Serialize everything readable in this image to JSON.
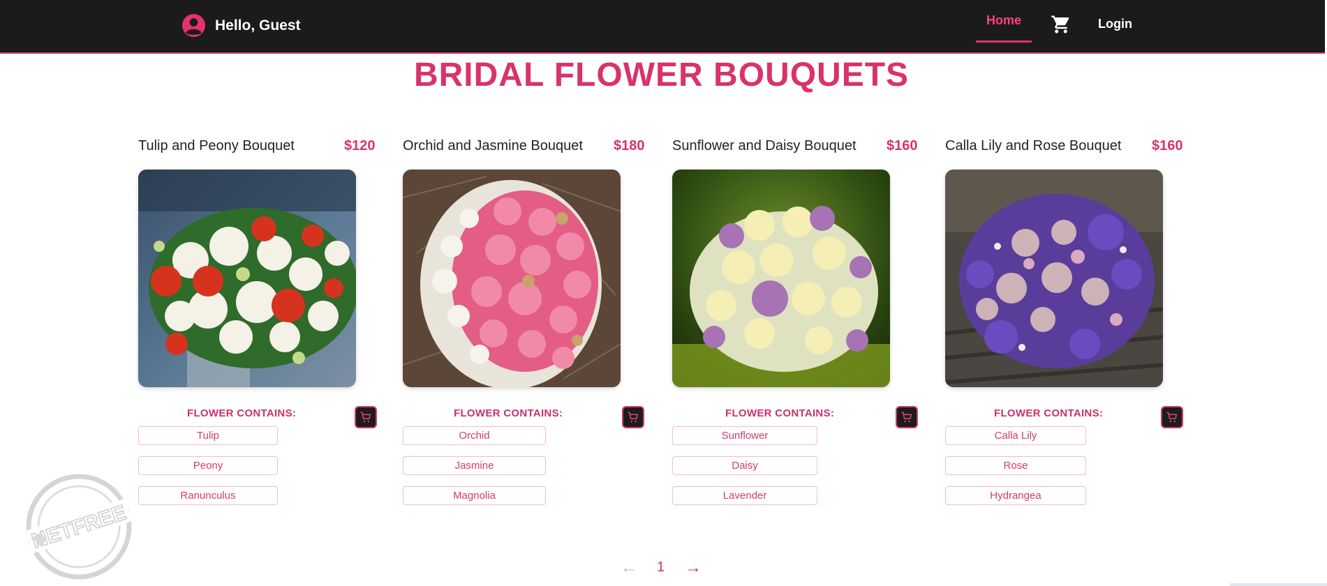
{
  "header": {
    "greeting": "Hello, Guest",
    "nav": {
      "home": "Home",
      "login": "Login"
    },
    "icons": {
      "user": "user-circle-icon",
      "cart": "shopping-cart-icon"
    }
  },
  "page": {
    "title": "BRIDAL FLOWER BOUQUETS"
  },
  "contains_label": "FLOWER CONTAINS:",
  "products": [
    {
      "name": "Tulip and Peony Bouquet",
      "price": "$120",
      "flowers": [
        "Tulip",
        "Peony",
        "Ranunculus"
      ]
    },
    {
      "name": "Orchid and Jasmine Bouquet",
      "price": "$180",
      "flowers": [
        "Orchid",
        "Jasmine",
        "Magnolia"
      ]
    },
    {
      "name": "Sunflower and Daisy Bouquet",
      "price": "$160",
      "flowers": [
        "Sunflower",
        "Daisy",
        "Lavender"
      ]
    },
    {
      "name": "Calla Lily and Rose Bouquet",
      "price": "$160",
      "flowers": [
        "Calla Lily",
        "Rose",
        "Hydrangea"
      ]
    }
  ],
  "pagination": {
    "prev": "←",
    "current": "1",
    "next": "→"
  },
  "watermark": {
    "text": "NETFREE"
  },
  "colors": {
    "accent": "#d8336b",
    "header_bg": "#1b1b1b",
    "chip_border": "#f4b9cf"
  }
}
